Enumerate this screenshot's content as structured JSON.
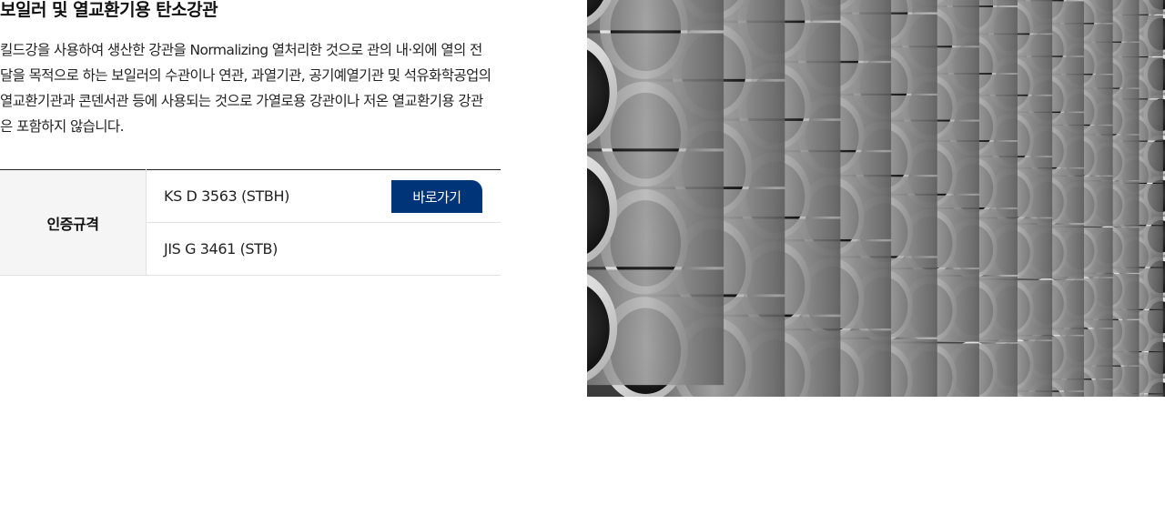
{
  "product": {
    "title": "보일러 및 열교환기용 탄소강관",
    "description": "킬드강을 사용하여 생산한 강관을 Normalizing 열처리한 것으로 관의 내·외에 열의 전달을 목적으로 하는 보일러의 수관이나 연관, 과열기관, 공기예열기관 및 석유화학공업의 열교환기관과 콘덴서관 등에 사용되는 것으로 가열로용 강관이나 저온 열교환기용 강관은 포함하지 않습니다."
  },
  "certification": {
    "header": "인증규격",
    "standards": [
      {
        "name": "KS D 3563 (STBH)",
        "button_label": "바로가기"
      },
      {
        "name": "JIS G 3461 (STB)"
      }
    ]
  },
  "image": {
    "subject": "stacked steel pipes",
    "colors": {
      "background": "#2a2a2a",
      "pipe_rim": "#e9e9e9",
      "pipe_inner": "#222222"
    }
  }
}
